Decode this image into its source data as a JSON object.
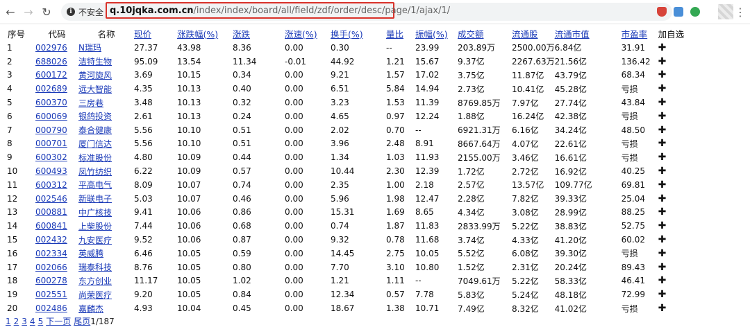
{
  "browser": {
    "insecure_label": "不安全",
    "url_host": "q.10jqka.com.cn",
    "url_path": "/index/index/board/all/field/zdf/order/desc/page/1/ajax/1/"
  },
  "table": {
    "headers": [
      "序号",
      "代码",
      "名称",
      "现价",
      "涨跌幅(%)",
      "涨跌",
      "涨速(%)",
      "换手(%)",
      "量比",
      "振幅(%)",
      "成交额",
      "流通股",
      "流通市值",
      "市盈率",
      "加自选"
    ],
    "rows": [
      [
        "1",
        "002976",
        "N瑞玛",
        "27.37",
        "43.98",
        "8.36",
        "0.00",
        "0.30",
        "--",
        "23.99",
        "203.89万",
        "2500.00万",
        "6.84亿",
        "31.91"
      ],
      [
        "2",
        "688026",
        "洁特生物",
        "95.09",
        "13.54",
        "11.34",
        "-0.01",
        "44.92",
        "1.21",
        "15.67",
        "9.37亿",
        "2267.63万",
        "21.56亿",
        "136.42"
      ],
      [
        "3",
        "600172",
        "黄河旋风",
        "3.69",
        "10.15",
        "0.34",
        "0.00",
        "9.21",
        "1.57",
        "17.02",
        "3.75亿",
        "11.87亿",
        "43.79亿",
        "68.34"
      ],
      [
        "4",
        "002689",
        "远大智能",
        "4.35",
        "10.13",
        "0.40",
        "0.00",
        "6.51",
        "5.84",
        "14.94",
        "2.73亿",
        "10.41亿",
        "45.28亿",
        "亏损"
      ],
      [
        "5",
        "600370",
        "三房巷",
        "3.48",
        "10.13",
        "0.32",
        "0.00",
        "3.23",
        "1.53",
        "11.39",
        "8769.85万",
        "7.97亿",
        "27.74亿",
        "43.84"
      ],
      [
        "6",
        "600069",
        "银鸽投资",
        "2.61",
        "10.13",
        "0.24",
        "0.00",
        "4.65",
        "0.97",
        "12.24",
        "1.88亿",
        "16.24亿",
        "42.38亿",
        "亏损"
      ],
      [
        "7",
        "000790",
        "泰合健康",
        "5.56",
        "10.10",
        "0.51",
        "0.00",
        "2.02",
        "0.70",
        "--",
        "6921.31万",
        "6.16亿",
        "34.24亿",
        "48.50"
      ],
      [
        "8",
        "000701",
        "厦门信达",
        "5.56",
        "10.10",
        "0.51",
        "0.00",
        "3.96",
        "2.48",
        "8.91",
        "8667.64万",
        "4.07亿",
        "22.61亿",
        "亏损"
      ],
      [
        "9",
        "600302",
        "标准股份",
        "4.80",
        "10.09",
        "0.44",
        "0.00",
        "1.34",
        "1.03",
        "11.93",
        "2155.00万",
        "3.46亿",
        "16.61亿",
        "亏损"
      ],
      [
        "10",
        "600493",
        "凤竹纺织",
        "6.22",
        "10.09",
        "0.57",
        "0.00",
        "10.44",
        "2.30",
        "12.39",
        "1.72亿",
        "2.72亿",
        "16.92亿",
        "40.25"
      ],
      [
        "11",
        "600312",
        "平高电气",
        "8.09",
        "10.07",
        "0.74",
        "0.00",
        "2.35",
        "1.00",
        "2.18",
        "2.57亿",
        "13.57亿",
        "109.77亿",
        "69.81"
      ],
      [
        "12",
        "002546",
        "新联电子",
        "5.03",
        "10.07",
        "0.46",
        "0.00",
        "5.96",
        "1.98",
        "12.47",
        "2.28亿",
        "7.82亿",
        "39.33亿",
        "25.04"
      ],
      [
        "13",
        "000881",
        "中广核技",
        "9.41",
        "10.06",
        "0.86",
        "0.00",
        "15.31",
        "1.69",
        "8.65",
        "4.34亿",
        "3.08亿",
        "28.99亿",
        "88.25"
      ],
      [
        "14",
        "600841",
        "上柴股份",
        "7.44",
        "10.06",
        "0.68",
        "0.00",
        "0.74",
        "1.87",
        "11.83",
        "2833.99万",
        "5.22亿",
        "38.83亿",
        "52.75"
      ],
      [
        "15",
        "002432",
        "九安医疗",
        "9.52",
        "10.06",
        "0.87",
        "0.00",
        "9.32",
        "0.78",
        "11.68",
        "3.74亿",
        "4.33亿",
        "41.20亿",
        "60.02"
      ],
      [
        "16",
        "002334",
        "英威腾",
        "6.46",
        "10.05",
        "0.59",
        "0.00",
        "14.45",
        "2.75",
        "10.05",
        "5.52亿",
        "6.08亿",
        "39.30亿",
        "亏损"
      ],
      [
        "17",
        "002066",
        "瑞泰科技",
        "8.76",
        "10.05",
        "0.80",
        "0.00",
        "7.70",
        "3.10",
        "10.80",
        "1.52亿",
        "2.31亿",
        "20.24亿",
        "89.43"
      ],
      [
        "18",
        "600278",
        "东方创业",
        "11.17",
        "10.05",
        "1.02",
        "0.00",
        "1.21",
        "1.11",
        "--",
        "7049.61万",
        "5.22亿",
        "58.33亿",
        "46.41"
      ],
      [
        "19",
        "002551",
        "尚荣医疗",
        "9.20",
        "10.05",
        "0.84",
        "0.00",
        "12.34",
        "0.57",
        "7.78",
        "5.83亿",
        "5.24亿",
        "48.18亿",
        "72.99"
      ],
      [
        "20",
        "002486",
        "嘉麟杰",
        "4.93",
        "10.04",
        "0.45",
        "0.00",
        "18.67",
        "1.38",
        "10.71",
        "7.49亿",
        "8.32亿",
        "41.02亿",
        "亏损"
      ]
    ],
    "add_symbol": "✚"
  },
  "pager": {
    "pages": [
      "1",
      "2",
      "3",
      "4",
      "5"
    ],
    "next": "下一页",
    "last": "尾页",
    "count": "1/187"
  }
}
